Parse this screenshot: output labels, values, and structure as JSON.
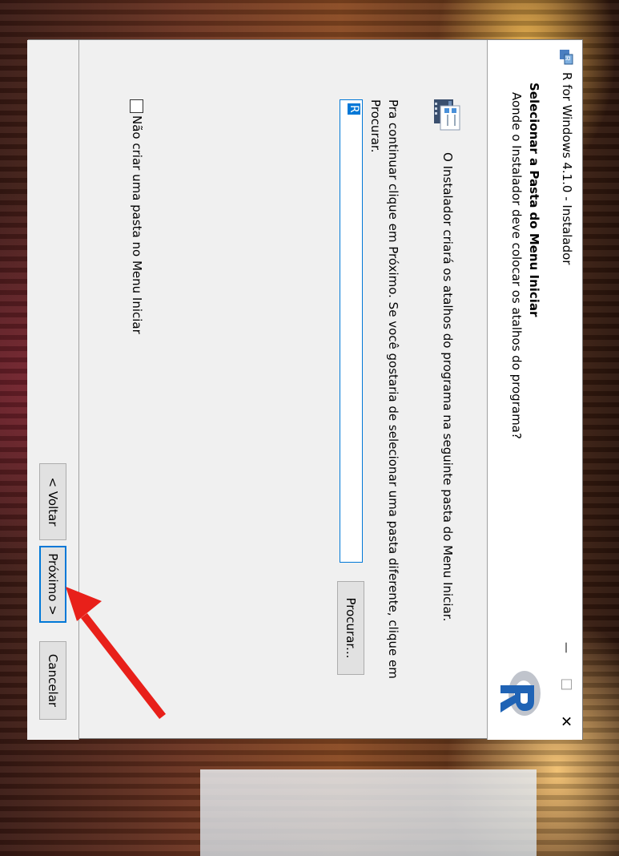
{
  "window": {
    "title": "R for Windows 4.1.0 - Instalador",
    "minimize_glyph": "—",
    "maximize_glyph": "☐",
    "close_glyph": "✕"
  },
  "header": {
    "title": "Selecionar a Pasta do Menu Iniciar",
    "subtitle": "Aonde o Instalador deve colocar os atalhos do programa?"
  },
  "content": {
    "description": "O Instalador criará os atalhos do programa na seguinte pasta do Menu Iniciar.",
    "instructions": "Pra continuar clique em Próximo. Se você gostaria de selecionar uma pasta diferente, clique em Procurar.",
    "folder_value": "R",
    "browse_label": "Procurar...",
    "no_folder_checkbox_label": "Não criar uma pasta no Menu Iniciar",
    "no_folder_checked": false
  },
  "footer": {
    "back_label": "< Voltar",
    "next_label": "Próximo >",
    "cancel_label": "Cancelar"
  },
  "colors": {
    "accent": "#0078d7",
    "annotation_arrow": "#e8201a"
  },
  "icons": [
    "r-setup-icon",
    "r-logo-icon",
    "start-menu-folder-icon",
    "red-arrow-annotation-icon"
  ]
}
